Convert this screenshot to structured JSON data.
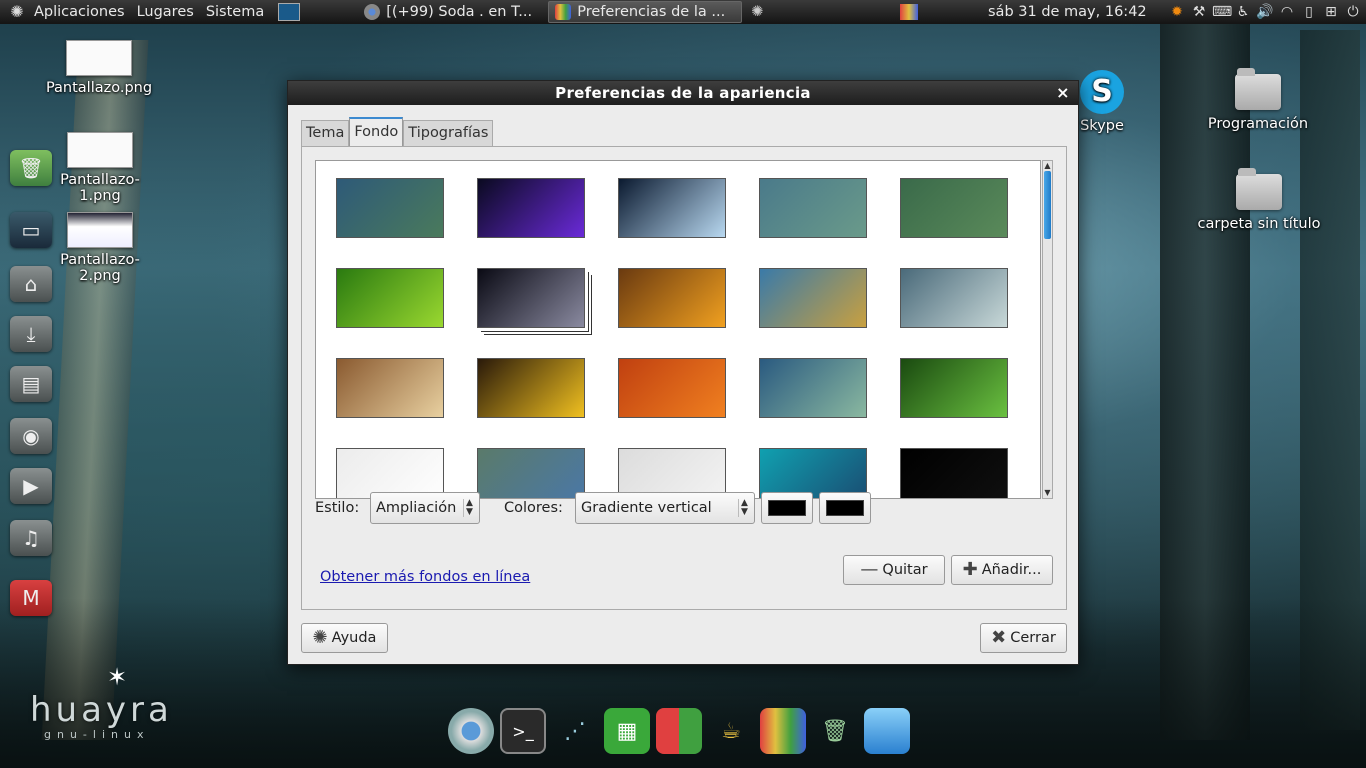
{
  "top_panel": {
    "menus": [
      "Aplicaciones",
      "Lugares",
      "Sistema"
    ],
    "tasks": [
      {
        "label": "[(+99) Soda . en T...",
        "icon": "chrome-icon",
        "active": false
      },
      {
        "label": "Preferencias de la ...",
        "icon": "appearance-icon",
        "active": true
      }
    ],
    "clock": "sáb 31 de may, 16:42"
  },
  "desktop": {
    "left_files": [
      "Pantallazo.png",
      "Pantallazo-1.png",
      "Pantallazo-2.png"
    ],
    "right_icons": [
      "Skype",
      "Programación",
      "carpeta sin título"
    ],
    "brand": "huayra",
    "brand_sub": "gnu-linux"
  },
  "dialog": {
    "title": "Preferencias de la apariencia",
    "tabs": [
      "Tema",
      "Fondo",
      "Tipografías"
    ],
    "active_tab": "Fondo",
    "wallpapers": [
      "#2e5a78|#4a7a5c",
      "#0a0a20|#6a2ad8",
      "#0b1a30|#b8d8f0",
      "#4a7a8a|#6a9a8a",
      "#3a6a4a|#5a8a5a",
      "#2a7a10|#9ad830",
      "#0a0a14|#8a8aa0",
      "#6a3a10|#f0a020",
      "#3a7aa8|#c8a040",
      "#4a6a7a|#c8d8d8",
      "#8a5a30|#e8d0a0",
      "#2a1a0a|#f0c020",
      "#c04010|#f08020",
      "#2a5a80|#8ab8a0",
      "#1a4a10|#6ac040",
      "#ececec|#ffffff",
      "#5a7a6a|#4a78a8",
      "#dcdcdc|#f4f4f4",
      "#10a0b0|#1a4a70",
      "#000000|#101010"
    ],
    "stacked_index": 6,
    "style_label": "Estilo:",
    "style_value": "Ampliación",
    "colors_label": "Colores:",
    "colors_value": "Gradiente vertical",
    "color_1": "#000000",
    "color_2": "#000000",
    "online_link": "Obtener más fondos en línea",
    "remove_label": "Quitar",
    "add_label": "Añadir...",
    "help_label": "Ayuda",
    "close_label": "Cerrar"
  },
  "accent_color": "#3c8ad0"
}
